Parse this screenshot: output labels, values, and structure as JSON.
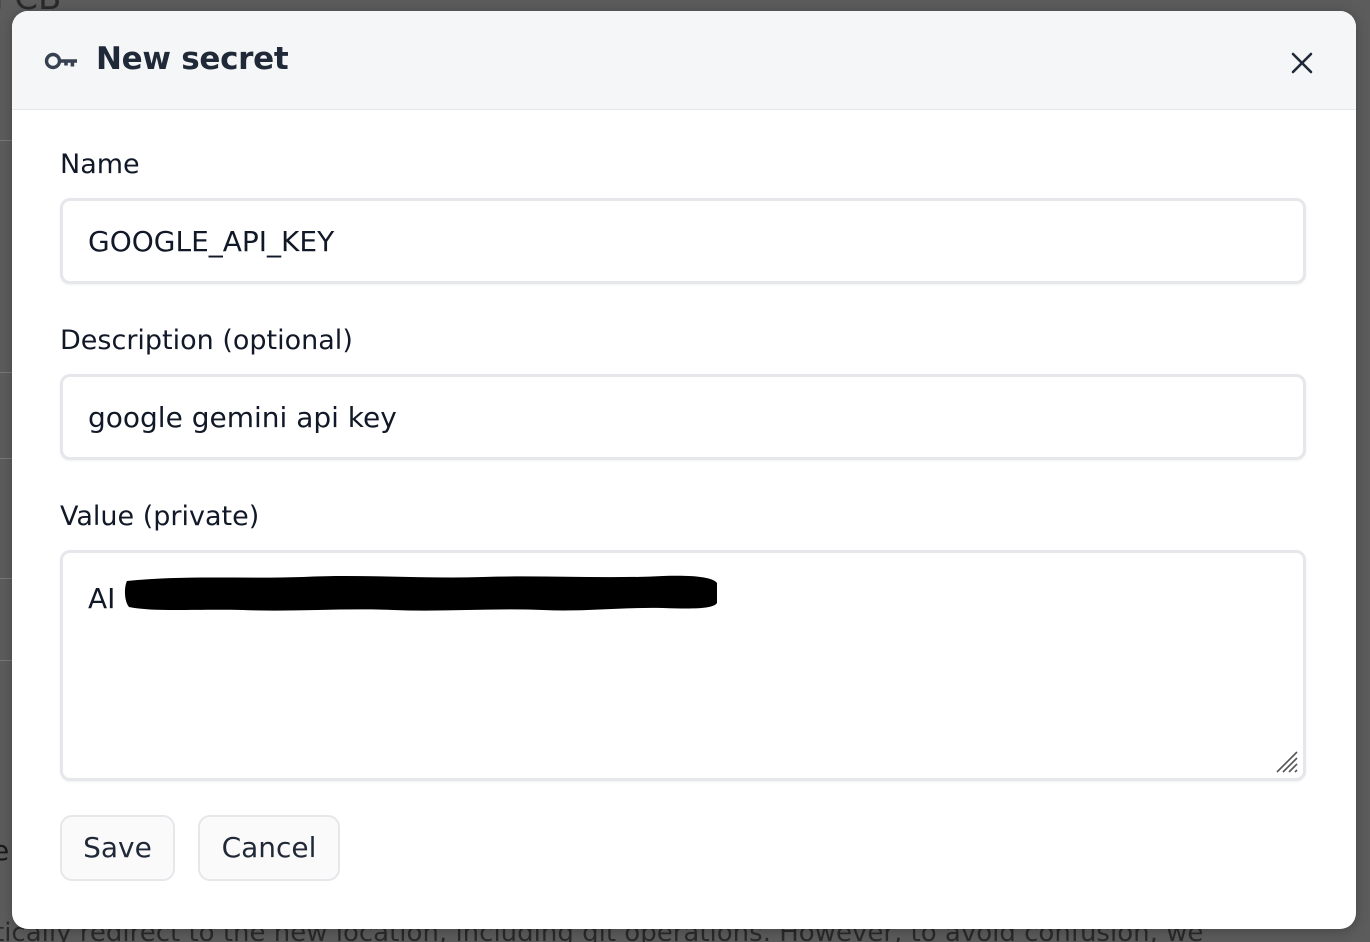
{
  "background": {
    "top_text": "l CB",
    "left_text": "e",
    "bottom_text": "tically redirect to the new location, including git operations. However, to avoid confusion, we"
  },
  "dialog": {
    "title": "New secret",
    "icon": "key-icon",
    "close_icon": "close-icon"
  },
  "form": {
    "name": {
      "label": "Name",
      "value": "GOOGLE_API_KEY"
    },
    "description": {
      "label": "Description (optional)",
      "value": "google gemini api key"
    },
    "value": {
      "label": "Value (private)",
      "visible_prefix": "AI",
      "redacted": true
    }
  },
  "buttons": {
    "save_label": "Save",
    "cancel_label": "Cancel"
  },
  "colors": {
    "overlay": "#5c5c5c",
    "header_bg": "#f5f6f8",
    "border": "#e5e7eb",
    "text": "#111827"
  }
}
